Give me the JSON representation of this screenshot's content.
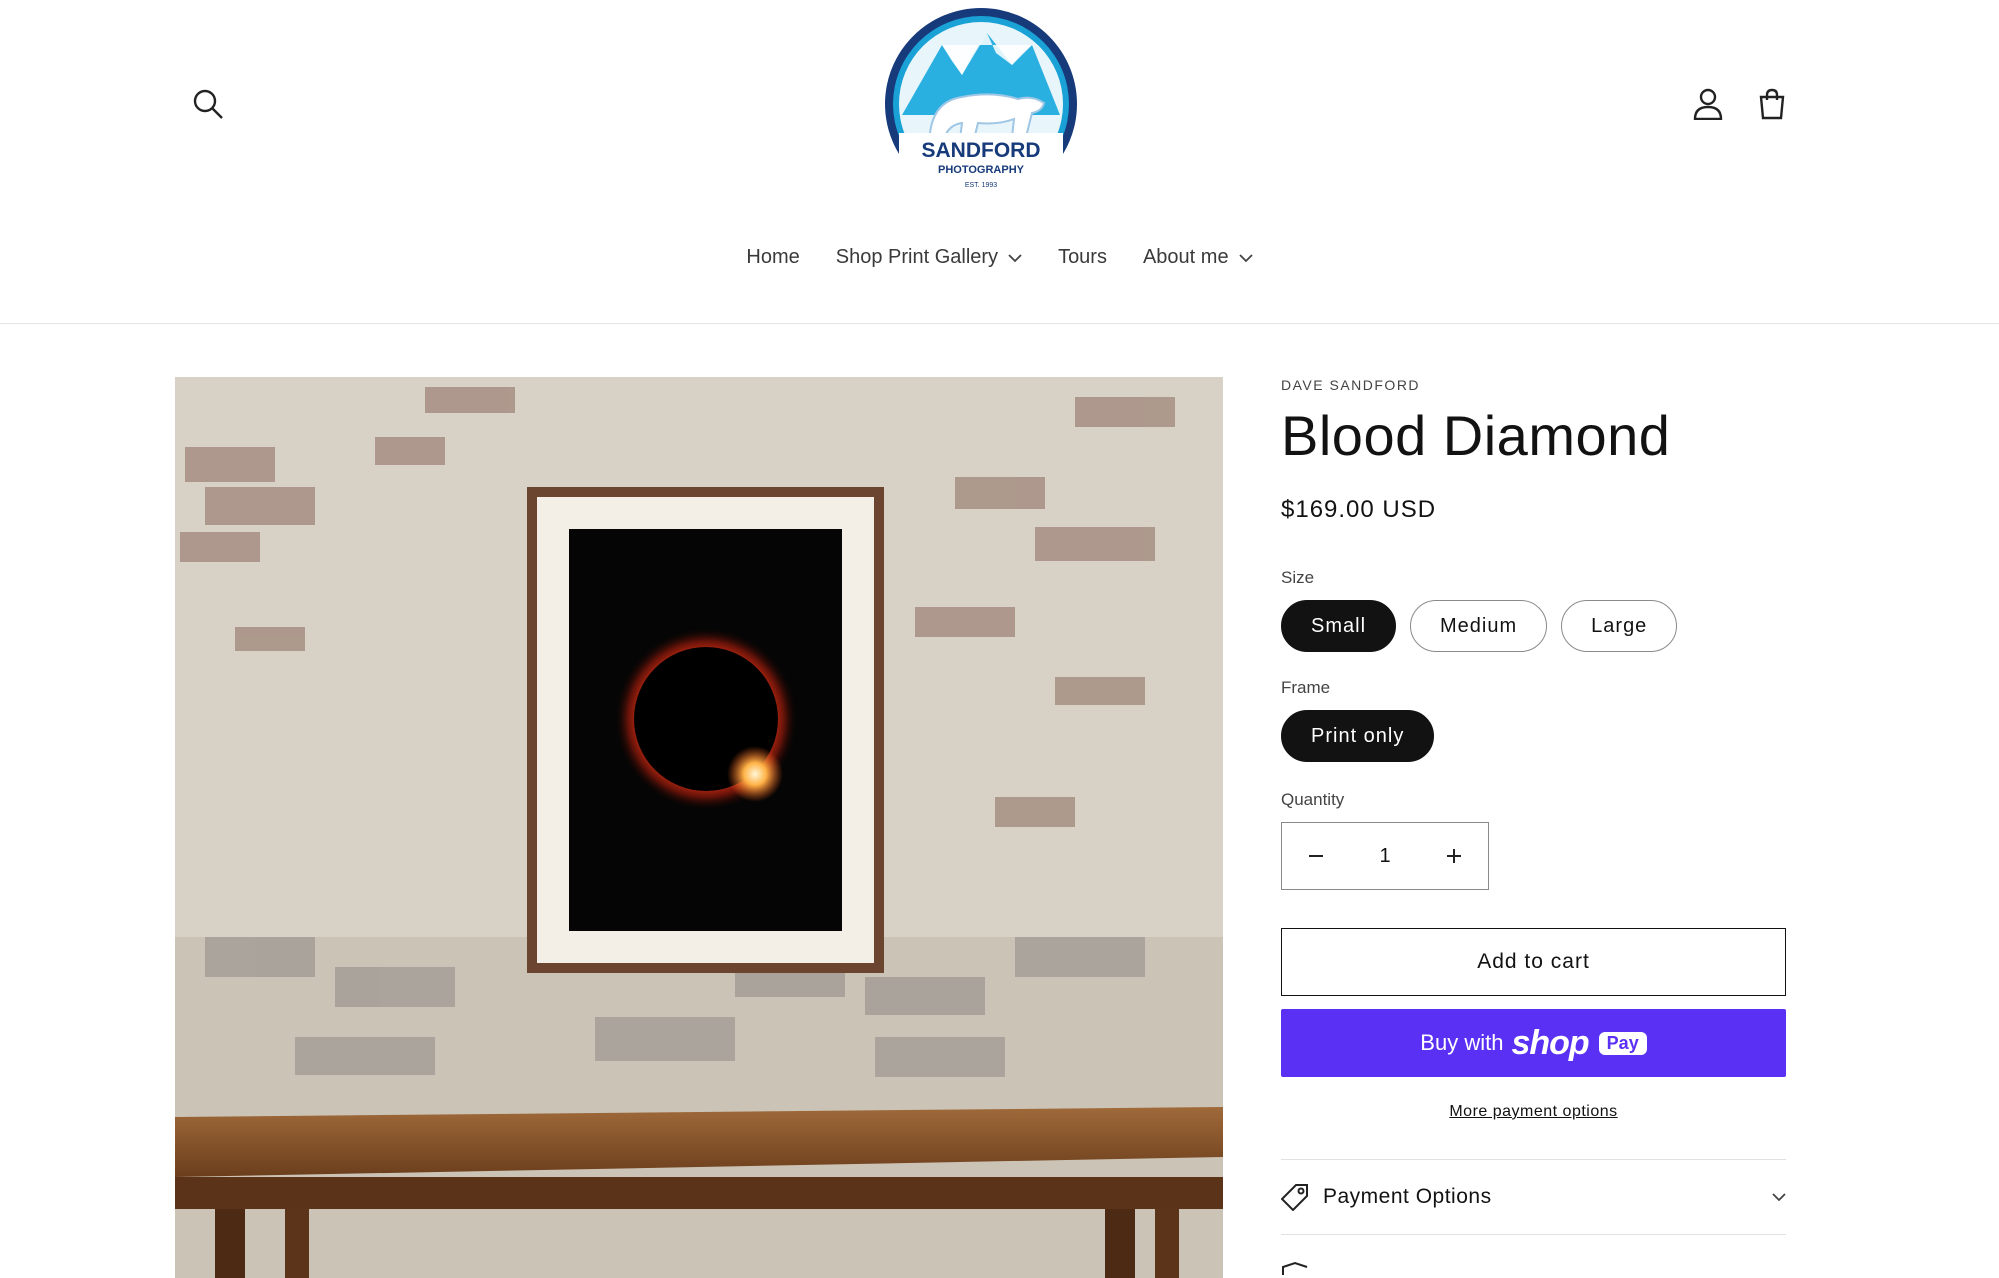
{
  "brand": {
    "name": "SANDFORD",
    "sub": "PHOTOGRAPHY",
    "est": "EST. 1993"
  },
  "nav": {
    "home": "Home",
    "shop": "Shop Print Gallery",
    "tours": "Tours",
    "about": "About me"
  },
  "product": {
    "vendor": "DAVE SANDFORD",
    "title": "Blood Diamond",
    "price": "$169.00 USD",
    "size_label": "Size",
    "sizes": [
      "Small",
      "Medium",
      "Large"
    ],
    "selected_size": "Small",
    "frame_label": "Frame",
    "frames": [
      "Print only"
    ],
    "selected_frame": "Print only",
    "quantity_label": "Quantity",
    "quantity": "1",
    "add_to_cart": "Add to cart",
    "buy_with": "Buy with",
    "shop_word": "shop",
    "pay_word": "Pay",
    "more_payment": "More payment options",
    "accordion_payment": "Payment Options"
  },
  "colors": {
    "shop_pay": "#5a31f4",
    "selected_pill": "#121212",
    "logo_blue": "#1aa1d6",
    "logo_navy": "#173a7a"
  },
  "icons": [
    "search-icon",
    "account-icon",
    "cart-icon",
    "chevron-down-icon",
    "tag-icon",
    "minus-icon",
    "plus-icon"
  ]
}
